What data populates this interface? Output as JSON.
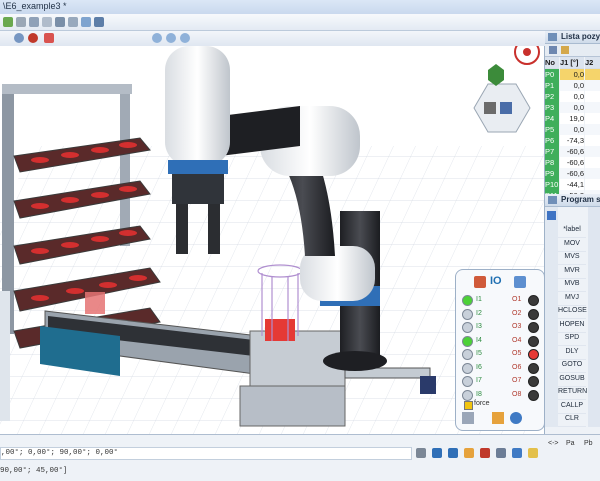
{
  "window": {
    "title": "\\E6_example3 *"
  },
  "right_top_panel": {
    "title": "Lista pozycji",
    "columns": [
      "No",
      "J1 [°]",
      "J2"
    ],
    "rows": [
      {
        "no": "P0",
        "j1": "0,0",
        "j2": "",
        "selected": true
      },
      {
        "no": "P1",
        "j1": "0,0",
        "j2": ""
      },
      {
        "no": "P2",
        "j1": "0,0",
        "j2": ""
      },
      {
        "no": "P3",
        "j1": "0,0",
        "j2": ""
      },
      {
        "no": "P4",
        "j1": "19,0",
        "j2": ""
      },
      {
        "no": "P5",
        "j1": "0,0",
        "j2": ""
      },
      {
        "no": "P6",
        "j1": "-74,3",
        "j2": ""
      },
      {
        "no": "P7",
        "j1": "-60,6",
        "j2": ""
      },
      {
        "no": "P8",
        "j1": "-60,6",
        "j2": ""
      },
      {
        "no": "P9",
        "j1": "-60,6",
        "j2": ""
      },
      {
        "no": "P10",
        "j1": "-44,1",
        "j2": ""
      },
      {
        "no": "P11",
        "j1": "-56,2",
        "j2": ""
      }
    ]
  },
  "program_panel": {
    "title": "Program steps",
    "commands": [
      "*label",
      "MOV",
      "MVS",
      "MVR",
      "MVB",
      "MVJ",
      "HCLOSE",
      "HOPEN",
      "SPD",
      "DLY",
      "GOTO",
      "GOSUB",
      "RETURN",
      "CALLP",
      "CLR"
    ],
    "footer": [
      "<->",
      "Pa",
      "Pb"
    ]
  },
  "io_panel": {
    "title": "IO",
    "inputs": [
      {
        "label": "I1",
        "on": true
      },
      {
        "label": "I2",
        "on": false
      },
      {
        "label": "I3",
        "on": false
      },
      {
        "label": "I4",
        "on": true
      },
      {
        "label": "I5",
        "on": false
      },
      {
        "label": "I6",
        "on": false
      },
      {
        "label": "I7",
        "on": false
      },
      {
        "label": "I8",
        "on": false
      }
    ],
    "outputs": [
      {
        "label": "O1",
        "on": false
      },
      {
        "label": "O2",
        "on": false
      },
      {
        "label": "O3",
        "on": false
      },
      {
        "label": "O4",
        "on": false
      },
      {
        "label": "O5",
        "on": true
      },
      {
        "label": "O6",
        "on": false
      },
      {
        "label": "O7",
        "on": false
      },
      {
        "label": "O8",
        "on": false
      }
    ],
    "force_label": "force"
  },
  "bottom": {
    "coords_top": ",00°;   0,00°;   90,00°;   0,00°",
    "coords_bottom": "90,00°; 45,00°]"
  },
  "colors": {
    "accent": "#2f6fb7",
    "led_on_green": "#4cd137",
    "led_on_red": "#e53935",
    "led_off": "#3a3a3a",
    "highlight_row": "#f5d46b"
  },
  "icons": [
    "save-icon",
    "zoom-in-icon",
    "zoom-out-icon",
    "zoom-fit-icon",
    "view-cube-icon",
    "camera-icon",
    "io-chart-icon",
    "refresh-icon"
  ]
}
